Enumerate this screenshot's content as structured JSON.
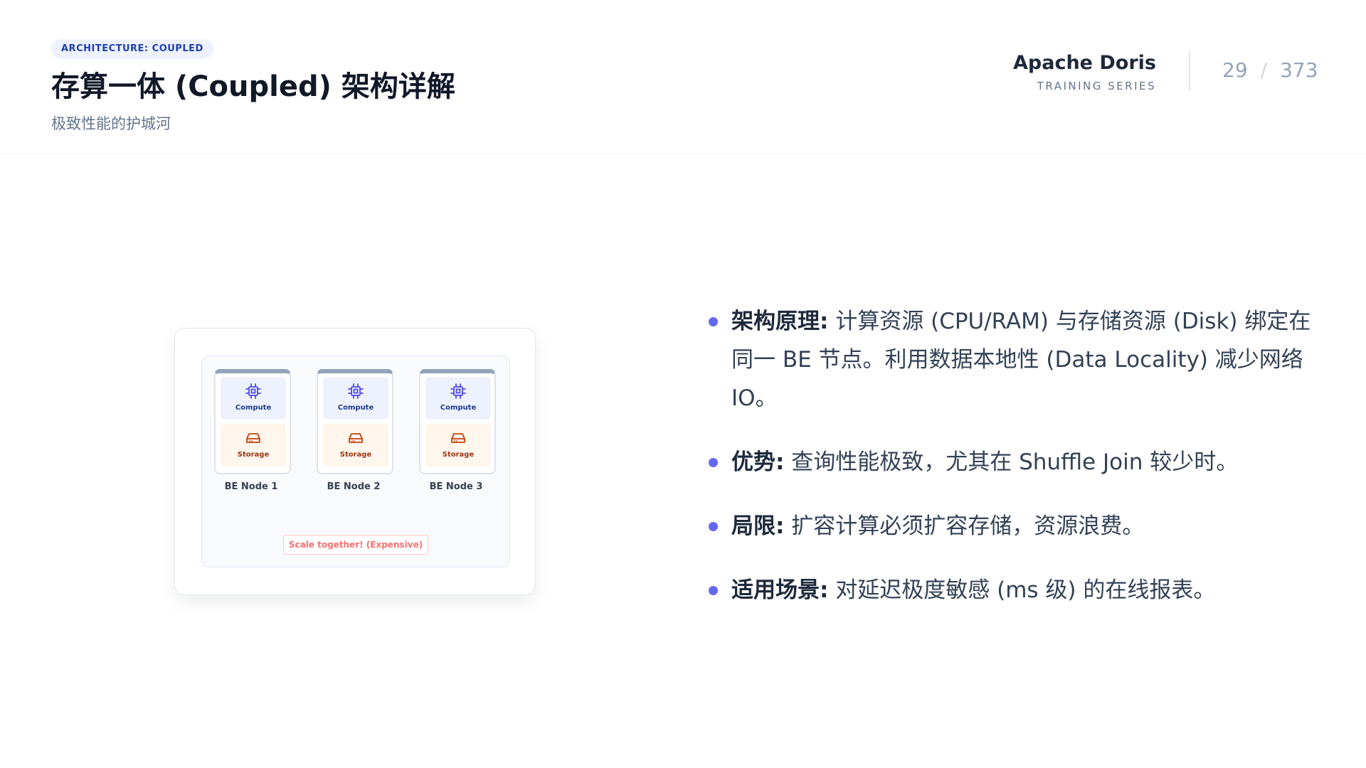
{
  "header": {
    "tag": "ARCHITECTURE: COUPLED",
    "title": "存算一体 (Coupled) 架构详解",
    "subtitle": "极致性能的护城河",
    "brand_name": "Apache Doris",
    "brand_sub": "TRAINING SERIES",
    "page_current": "29",
    "page_sep": "/",
    "page_total": "373"
  },
  "diagram": {
    "nodes": [
      {
        "compute": "Compute",
        "storage": "Storage",
        "label": "BE Node 1"
      },
      {
        "compute": "Compute",
        "storage": "Storage",
        "label": "BE Node 2"
      },
      {
        "compute": "Compute",
        "storage": "Storage",
        "label": "BE Node 3"
      }
    ],
    "note": "Scale together! (Expensive)",
    "icons": {
      "compute": "cpu-chip-icon",
      "storage": "hard-drive-icon"
    },
    "colors": {
      "compute": "#4f46e5",
      "storage": "#c2410c"
    }
  },
  "bullets": [
    {
      "label": "架构原理:",
      "text": " 计算资源 (CPU/RAM) 与存储资源 (Disk) 绑定在同一 BE 节点。利用数据本地性 (Data Locality) 减少网络 IO。"
    },
    {
      "label": "优势:",
      "text": " 查询性能极致，尤其在 Shuffle Join 较少时。"
    },
    {
      "label": "局限:",
      "text": " 扩容计算必须扩容存储，资源浪费。"
    },
    {
      "label": "适用场景:",
      "text": " 对延迟极度敏感 (ms 级) 的在线报表。"
    }
  ],
  "colors": {
    "accent": "#6366f1",
    "tag_bg": "#eef2ff",
    "tag_text": "#1e40af"
  }
}
